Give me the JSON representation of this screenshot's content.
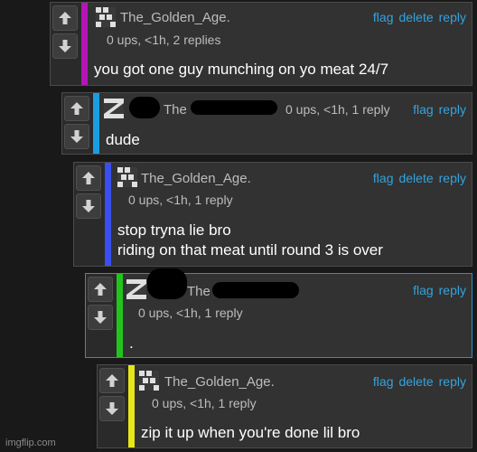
{
  "comments": [
    {
      "username": "The_Golden_Age.",
      "meta": "0 ups, <1h, 2 replies",
      "body": [
        "you got one guy munching on yo meat 24/7"
      ],
      "actions": [
        "flag",
        "delete",
        "reply"
      ],
      "stripe_color": "#b515b8"
    },
    {
      "username": "The",
      "meta": "0 ups, <1h, 1 reply",
      "body": [
        "dude"
      ],
      "actions": [
        "flag",
        "reply"
      ],
      "stripe_color": "#1b9de2"
    },
    {
      "username": "The_Golden_Age.",
      "meta": "0 ups, <1h, 1 reply",
      "body": [
        "stop tryna lie bro",
        "riding on that meat until round 3 is over"
      ],
      "actions": [
        "flag",
        "delete",
        "reply"
      ],
      "stripe_color": "#3a4ff0"
    },
    {
      "username": "The",
      "meta": "0 ups, <1h, 1 reply",
      "body": [
        "."
      ],
      "actions": [
        "flag",
        "reply"
      ],
      "stripe_color": "#22c41c"
    },
    {
      "username": "The_Golden_Age.",
      "meta": "0 ups, <1h, 1 reply",
      "body": [
        "zip it up when you're done lil bro"
      ],
      "actions": [
        "flag",
        "delete",
        "reply"
      ],
      "stripe_color": "#e6e61a"
    }
  ],
  "icons": {
    "upvote": "arrow-up-icon",
    "downvote": "arrow-down-icon"
  },
  "watermark": "imgflip.com"
}
